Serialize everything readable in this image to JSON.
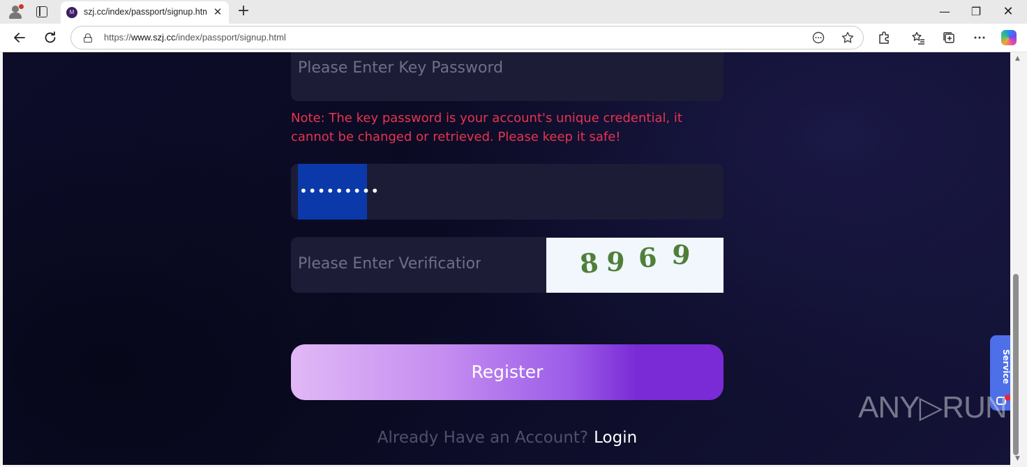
{
  "browser": {
    "tab_title": "szj.cc/index/passport/signup.html",
    "favicon_letter": "M",
    "tab_close_glyph": "✕",
    "new_tab_glyph": "+",
    "url_prefix": "https://",
    "url_host": "www.szj.cc",
    "url_path": "/index/passport/signup.html",
    "window_minimize": "—",
    "window_restore": "❐",
    "window_close": "✕",
    "icons": {
      "profile": "profile-icon",
      "tabs": "tab-actions-icon",
      "back": "back-arrow-icon",
      "reload": "reload-icon",
      "lock": "site-info-icon",
      "reader": "immersive-reader-icon",
      "favorite": "star-icon",
      "extensions": "puzzle-icon",
      "favorites": "favorites-list-icon",
      "collections": "collections-icon",
      "more": "ellipsis-icon",
      "copilot": "copilot-icon"
    }
  },
  "form": {
    "key_password_placeholder": "Please Enter Key Password",
    "note": "Note: The key password is your account's unique credential, it cannot be changed or retrieved. Please keep it safe!",
    "password_masked": "•••••••••",
    "verification_placeholder": "Please Enter Verification Code",
    "captcha_digits": [
      "8",
      "9",
      "6",
      "9"
    ],
    "register_label": "Register",
    "have_account_text": "Already Have an Account?",
    "login_label": "Login"
  },
  "widgets": {
    "service_label": "Service",
    "watermark": "ANY▷RUN"
  },
  "colors": {
    "note": "#e8344f",
    "captcha_digit": "#4f7f3a",
    "register_gradient_start": "#e1b8f6",
    "register_gradient_end": "#7a2bd6",
    "service": "#4d6fe8",
    "selection": "#0b39a9"
  }
}
